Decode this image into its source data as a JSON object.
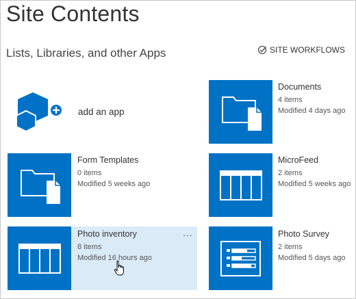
{
  "page": {
    "title": "Site Contents"
  },
  "section": {
    "title": "Lists, Libraries, and other Apps",
    "workflows_label": "SITE WORKFLOWS"
  },
  "add_app": {
    "label": "add an app"
  },
  "apps": [
    {
      "name": "Documents",
      "count": "4 items",
      "modified": "Modified 4 days ago",
      "icon": "folder-document-icon"
    },
    {
      "name": "Form Templates",
      "count": "0 items",
      "modified": "Modified 5 weeks ago",
      "icon": "folder-document-icon"
    },
    {
      "name": "MicroFeed",
      "count": "2 items",
      "modified": "Modified 5 weeks ago",
      "icon": "list-grid-icon"
    },
    {
      "name": "Photo inventory",
      "count": "8 items",
      "modified": "Modified 16 hours ago",
      "icon": "list-grid-icon",
      "more_label": "···"
    },
    {
      "name": "Photo Survey",
      "count": "2 items",
      "modified": "Modified 5 days ago",
      "icon": "survey-icon"
    }
  ],
  "colors": {
    "tile": "#0072c6",
    "hover": "#dbeaf7",
    "text": "#333333"
  }
}
